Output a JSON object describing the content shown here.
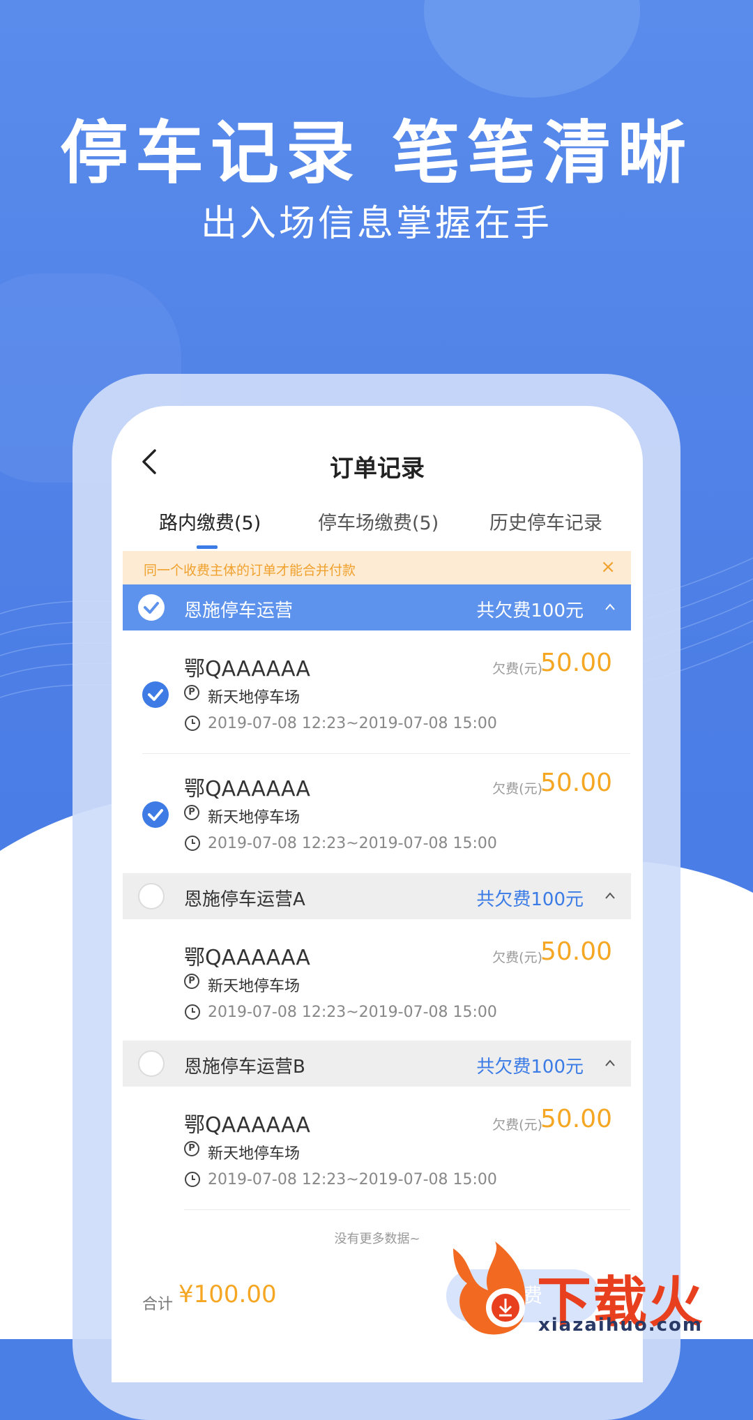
{
  "hero": {
    "title": "停车记录 笔笔清晰",
    "subtitle": "出入场信息掌握在手"
  },
  "nav": {
    "title": "订单记录"
  },
  "tabs": [
    {
      "label": "路内缴费(5)",
      "active": true
    },
    {
      "label": "停车场缴费(5)",
      "active": false
    },
    {
      "label": "历史停车记录",
      "active": false
    }
  ],
  "notice": {
    "text": "同一个收费主体的订单才能合并付款",
    "close": "×"
  },
  "groups": [
    {
      "name": "恩施停车运营",
      "total": "共欠费100元",
      "selected": true,
      "items": [
        {
          "plate": "鄂QAAAAAA",
          "lot": "新天地停车场",
          "time": "2019-07-08 12:23~2019-07-08 15:00",
          "fee_label": "欠费(元)",
          "fee": "50.00",
          "selected": true
        },
        {
          "plate": "鄂QAAAAAA",
          "lot": "新天地停车场",
          "time": "2019-07-08 12:23~2019-07-08 15:00",
          "fee_label": "欠费(元)",
          "fee": "50.00",
          "selected": true
        }
      ]
    },
    {
      "name": "恩施停车运营A",
      "total": "共欠费100元",
      "selected": false,
      "items": [
        {
          "plate": "鄂QAAAAAA",
          "lot": "新天地停车场",
          "time": "2019-07-08 12:23~2019-07-08 15:00",
          "fee_label": "欠费(元)",
          "fee": "50.00"
        }
      ]
    },
    {
      "name": "恩施停车运营B",
      "total": "共欠费100元",
      "selected": false,
      "items": [
        {
          "plate": "鄂QAAAAAA",
          "lot": "新天地停车场",
          "time": "2019-07-08 12:23~2019-07-08 15:00",
          "fee_label": "欠费(元)",
          "fee": "50.00"
        }
      ]
    }
  ],
  "footer": {
    "no_more": "没有更多数据~",
    "total_label": "合计",
    "total_value": "¥100.00",
    "pay_label": "缴费"
  },
  "watermark": {
    "brand": "下载火",
    "url": "xiazaihuo.com"
  },
  "colors": {
    "brand_blue": "#3a7be6",
    "fee_orange": "#f5a623",
    "notice_bg": "#fdebd4"
  }
}
